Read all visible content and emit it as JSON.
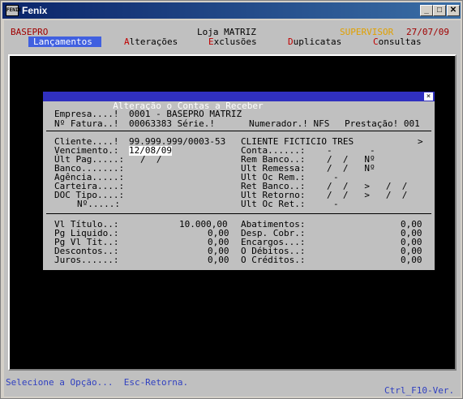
{
  "window": {
    "title": "Fenix",
    "icon_label": "FENIX",
    "controls": {
      "minimize": "_",
      "maximize": "□",
      "close": "✕"
    }
  },
  "header": {
    "company": "BASEPRO",
    "store": "Loja MATRIZ",
    "user": "SUPERVISOR",
    "date": "27/07/09"
  },
  "menu": [
    {
      "hot": "L",
      "rest": "ançamentos",
      "active": true
    },
    {
      "hot": "A",
      "rest": "lterações",
      "active": false
    },
    {
      "hot": "E",
      "rest": "xclusões",
      "active": false
    },
    {
      "hot": "D",
      "rest": "uplicatas",
      "active": false
    },
    {
      "hot": "C",
      "rest": "onsultas",
      "active": false
    }
  ],
  "dialog": {
    "title": "Alteração o Contas a Receber",
    "close": "×",
    "empresa_label": "Empresa....!",
    "empresa_value": "0001 - BASEPRO MATRIZ",
    "fatura_label": "Nº Fatura..!",
    "fatura_value": "00063383 Série.!",
    "numerador": "Numerador.! NFS",
    "prestacao": "Prestação! 001",
    "cliente_label": "Cliente....!",
    "cliente_value": "99.999.999/0003-53",
    "cliente_name": "CLIENTE FICTICIO TRES",
    "cliente_arrow": ">",
    "vencimento_label": "Vencimento.:",
    "vencimento_value": "12/08/09",
    "ultpag_label": "Últ Pag.....:",
    "ultpag_value": "/  /",
    "banco_label": "Banco.......:",
    "agencia_label": "Agência.....:",
    "carteira_label": "Carteira....:",
    "doctipo_label": "DOC Tipo....:",
    "numero_label": "Nº.....:",
    "conta_label": "Conta......:",
    "conta_value": "-       -",
    "remb_label": "Rem Banco..:",
    "remb_value": "/  /   Nº",
    "ultrem_label": "Ult Remessa:",
    "ultrem_value": "/  /   Nº",
    "ultocrem_label": "Ult Oc Rem.:",
    "ultocrem_value": "-",
    "retb_label": "Ret Banco..:",
    "retb_value": "/  /   >   /  /",
    "ultret_label": "Ult Retorno:",
    "ultret_value": "/  /   >   /  /",
    "ultocret_label": "Ult Oc Ret.:",
    "ultocret_value": "-",
    "vltitulo_label": "Vl Título..:",
    "vltitulo_value": "10.000,00",
    "pgliq_label": "Pg Liquido.:",
    "pgliq_value": "0,00",
    "pgvl_label": "Pg Vl Tit..:",
    "pgvl_value": "0,00",
    "desc_label": "Descontos..:",
    "desc_value": "0,00",
    "juros_label": "Juros......:",
    "juros_value": "0,00",
    "abat_label": "Abatimentos:",
    "abat_value": "0,00",
    "despc_label": "Desp. Cobr.:",
    "despc_value": "0,00",
    "encargos_label": "Encargos...:",
    "encargos_value": "0,00",
    "odeb_label": "O Débitos..:",
    "odeb_value": "0,00",
    "ocred_label": "O Créditos.:",
    "ocred_value": "0,00"
  },
  "status": {
    "left": "Selecione a Opção...  Esc-Retorna.",
    "right": "Ctrl_F10-Ver."
  }
}
